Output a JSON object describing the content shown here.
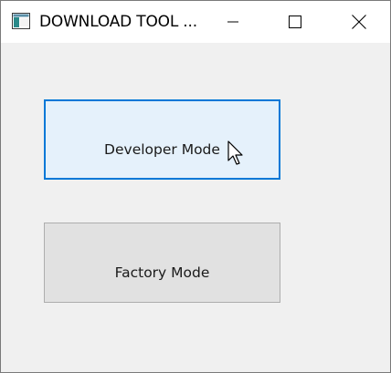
{
  "window": {
    "title": "DOWNLOAD TOOL ...",
    "icons": {
      "app": "app-window-icon",
      "minimize": "minimize-icon",
      "maximize": "maximize-icon",
      "close": "close-icon"
    }
  },
  "buttons": {
    "developer_mode": "Developer Mode",
    "factory_mode": "Factory Mode"
  },
  "colors": {
    "titlebar_bg": "#ffffff",
    "client_bg": "#f0f0f0",
    "hover_bg": "#e5f1fb",
    "hover_border": "#0078d7",
    "button_bg": "#e1e1e1",
    "button_border": "#adadad"
  },
  "cursor": "arrow-cursor-icon"
}
